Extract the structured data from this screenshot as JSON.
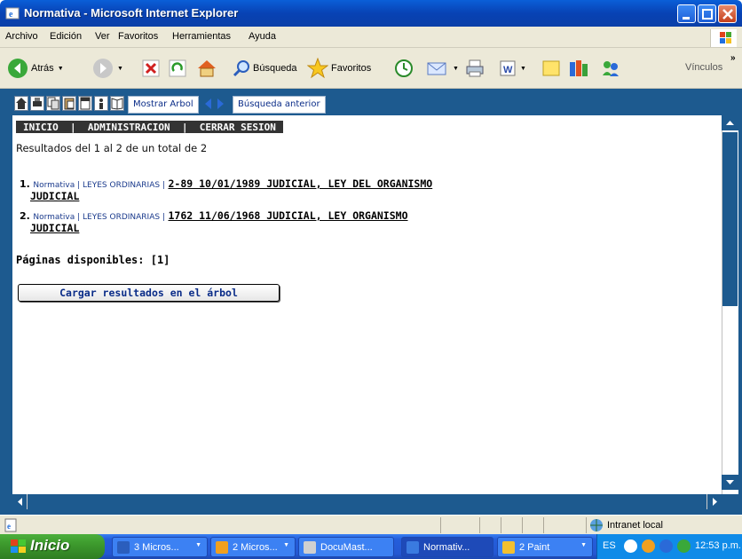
{
  "window": {
    "title": "Normativa - Microsoft Internet Explorer"
  },
  "menu": [
    "Archivo",
    "Edición",
    "Ver",
    "Favoritos",
    "Herramientas",
    "Ayuda"
  ],
  "toolbar": {
    "back": "Atrás",
    "search": "Búsqueda",
    "favorites": "Favoritos",
    "links": "Vínculos"
  },
  "frame_toolbar": {
    "show_tree": "Mostrar Arbol",
    "prev_search": "Búsqueda anterior"
  },
  "nav": {
    "home": "INICIO",
    "separator": "  |  ",
    "admin": "ADMINISTRACION",
    "logout": "CERRAR SESION"
  },
  "results": {
    "summary": "Resultados del 1 al 2 de un total de 2",
    "items": [
      {
        "num": "1.",
        "category": "Normativa | LEYES ORDINARIAS |",
        "title_line1": "2-89 10/01/1989 JUDICIAL, LEY DEL ORGANISMO",
        "title_line2": "JUDICIAL"
      },
      {
        "num": "2.",
        "category": "Normativa | LEYES ORDINARIAS |",
        "title_line1": "1762 11/06/1968 JUDICIAL, LEY ORGANISMO",
        "title_line2": "JUDICIAL"
      }
    ],
    "pages": "Páginas disponibles: [1]",
    "load_button": "Cargar resultados en el árbol"
  },
  "status": {
    "zone": "Intranet local"
  },
  "taskbar": {
    "start": "Inicio",
    "tasks": [
      {
        "label": "3 Micros...",
        "color": "#2b5ebd"
      },
      {
        "label": "2 Micros...",
        "color": "#f0a020"
      },
      {
        "label": "DocuMast...",
        "color": "#d0d0d0"
      },
      {
        "label": "Normativ...",
        "color": "#3a7be0"
      },
      {
        "label": "2 Paint",
        "color": "#f2c030"
      }
    ],
    "lang": "ES",
    "clock": "12:53 p.m."
  }
}
